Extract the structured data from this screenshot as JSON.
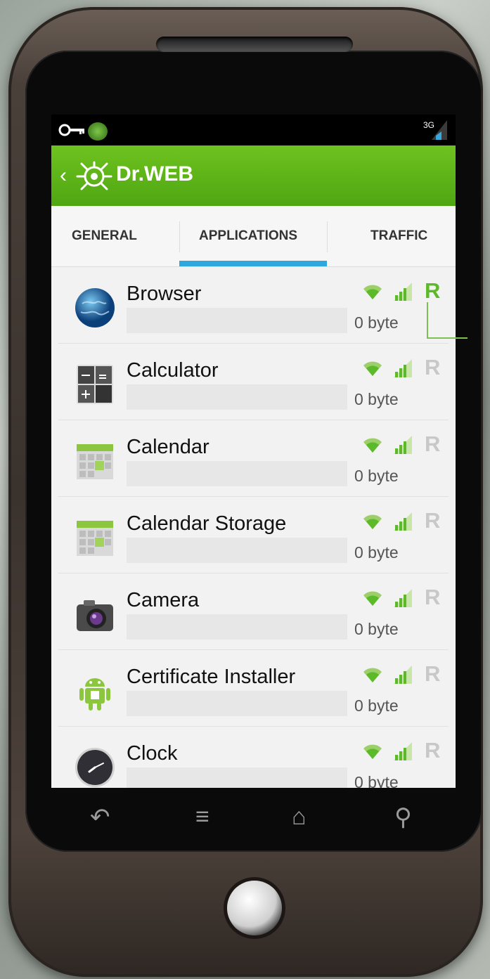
{
  "header": {
    "app_name": "Dr.WEB",
    "network": "3G"
  },
  "tabs": [
    {
      "label": "GENERAL"
    },
    {
      "label": "APPLICATIONS",
      "active": true
    },
    {
      "label": "TRAFFIC"
    }
  ],
  "apps": [
    {
      "name": "Browser",
      "size": "0 byte",
      "icon": "globe-icon",
      "roaming_enabled": true
    },
    {
      "name": "Calculator",
      "size": "0 byte",
      "icon": "calculator-icon",
      "roaming_enabled": false
    },
    {
      "name": "Calendar",
      "size": "0 byte",
      "icon": "calendar-icon",
      "roaming_enabled": false
    },
    {
      "name": "Calendar Storage",
      "size": "0 byte",
      "icon": "calendar-icon",
      "roaming_enabled": false
    },
    {
      "name": "Camera",
      "size": "0 byte",
      "icon": "camera-icon",
      "roaming_enabled": false
    },
    {
      "name": "Certificate Installer",
      "size": "0 byte",
      "icon": "android-icon",
      "roaming_enabled": false
    },
    {
      "name": "Clock",
      "size": "0 byte",
      "icon": "clock-icon",
      "roaming_enabled": false
    }
  ],
  "row_badge": "R",
  "colors": {
    "accent_green": "#5cba2a",
    "tab_indicator": "#2ea8dc",
    "appbar": "#5cb317"
  }
}
